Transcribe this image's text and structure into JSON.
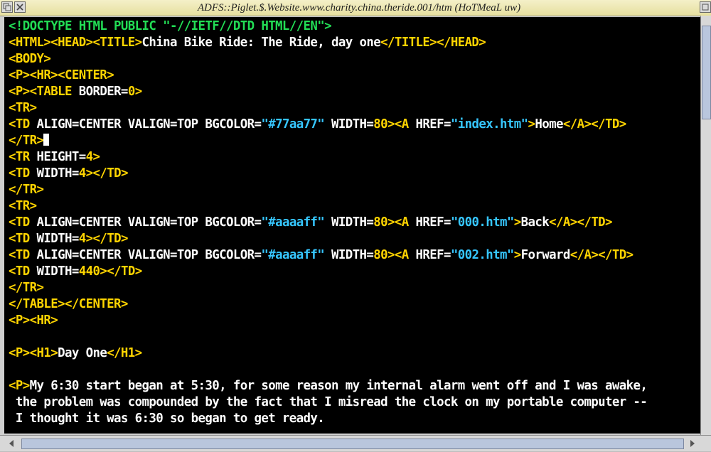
{
  "window": {
    "title": "ADFS::Piglet.$.Website.www.charity.china.theride.001/htm (HoTMeaL uw)"
  },
  "icons": [
    "back-icon",
    "close-icon",
    "toggle-size-icon",
    "scroll-left-arrow-icon",
    "scroll-right-arrow-icon"
  ],
  "colors": {
    "tag": "#ffd400",
    "comment": "#22dd55",
    "value": "#36c6ff",
    "text": "#ffffff",
    "background": "#000000"
  },
  "editor": {
    "lines": [
      [
        {
          "t": "c",
          "s": "<!DOCTYPE HTML PUBLIC \"-//IETF//DTD HTML//EN\">"
        }
      ],
      [
        {
          "t": "t",
          "s": "<HTML><HEAD><TITLE>"
        },
        {
          "t": "w",
          "s": "China Bike Ride: The Ride, day one"
        },
        {
          "t": "t",
          "s": "</TITLE></HEAD>"
        }
      ],
      [
        {
          "t": "t",
          "s": "<BODY>"
        }
      ],
      [
        {
          "t": "t",
          "s": "<P><HR><CENTER>"
        }
      ],
      [
        {
          "t": "t",
          "s": "<P><TABLE"
        },
        {
          "t": "w",
          "s": " BORDER="
        },
        {
          "t": "t",
          "s": "0"
        },
        {
          "t": "t",
          "s": ">"
        }
      ],
      [
        {
          "t": "t",
          "s": "<TR>"
        }
      ],
      [
        {
          "t": "t",
          "s": "<TD"
        },
        {
          "t": "w",
          "s": " ALIGN=CENTER VALIGN=TOP BGCOLOR="
        },
        {
          "t": "v",
          "s": "\"#77aa77\""
        },
        {
          "t": "w",
          "s": " WIDTH="
        },
        {
          "t": "t",
          "s": "80"
        },
        {
          "t": "t",
          "s": "><A"
        },
        {
          "t": "w",
          "s": " HREF="
        },
        {
          "t": "v",
          "s": "\"index.htm\""
        },
        {
          "t": "t",
          "s": ">"
        },
        {
          "t": "w",
          "s": "Home"
        },
        {
          "t": "t",
          "s": "</A></TD>"
        }
      ],
      [
        {
          "t": "t",
          "s": "</TR>"
        },
        {
          "t": "caret",
          "s": ""
        }
      ],
      [
        {
          "t": "t",
          "s": "<TR"
        },
        {
          "t": "w",
          "s": " HEIGHT="
        },
        {
          "t": "t",
          "s": "4"
        },
        {
          "t": "t",
          "s": ">"
        }
      ],
      [
        {
          "t": "t",
          "s": "<TD"
        },
        {
          "t": "w",
          "s": " WIDTH="
        },
        {
          "t": "t",
          "s": "4"
        },
        {
          "t": "t",
          "s": "></TD>"
        }
      ],
      [
        {
          "t": "t",
          "s": "</TR>"
        }
      ],
      [
        {
          "t": "t",
          "s": "<TR>"
        }
      ],
      [
        {
          "t": "t",
          "s": "<TD"
        },
        {
          "t": "w",
          "s": " ALIGN=CENTER VALIGN=TOP BGCOLOR="
        },
        {
          "t": "v",
          "s": "\"#aaaaff\""
        },
        {
          "t": "w",
          "s": " WIDTH="
        },
        {
          "t": "t",
          "s": "80"
        },
        {
          "t": "t",
          "s": "><A"
        },
        {
          "t": "w",
          "s": " HREF="
        },
        {
          "t": "v",
          "s": "\"000.htm\""
        },
        {
          "t": "t",
          "s": ">"
        },
        {
          "t": "w",
          "s": "Back"
        },
        {
          "t": "t",
          "s": "</A></TD>"
        }
      ],
      [
        {
          "t": "t",
          "s": "<TD"
        },
        {
          "t": "w",
          "s": " WIDTH="
        },
        {
          "t": "t",
          "s": "4"
        },
        {
          "t": "t",
          "s": "></TD>"
        }
      ],
      [
        {
          "t": "t",
          "s": "<TD"
        },
        {
          "t": "w",
          "s": " ALIGN=CENTER VALIGN=TOP BGCOLOR="
        },
        {
          "t": "v",
          "s": "\"#aaaaff\""
        },
        {
          "t": "w",
          "s": " WIDTH="
        },
        {
          "t": "t",
          "s": "80"
        },
        {
          "t": "t",
          "s": "><A"
        },
        {
          "t": "w",
          "s": " HREF="
        },
        {
          "t": "v",
          "s": "\"002.htm\""
        },
        {
          "t": "t",
          "s": ">"
        },
        {
          "t": "w",
          "s": "Forward"
        },
        {
          "t": "t",
          "s": "</A></TD>"
        }
      ],
      [
        {
          "t": "t",
          "s": "<TD"
        },
        {
          "t": "w",
          "s": " WIDTH="
        },
        {
          "t": "t",
          "s": "440"
        },
        {
          "t": "t",
          "s": "></TD>"
        }
      ],
      [
        {
          "t": "t",
          "s": "</TR>"
        }
      ],
      [
        {
          "t": "t",
          "s": "</TABLE></CENTER>"
        }
      ],
      [
        {
          "t": "t",
          "s": "<P><HR>"
        }
      ],
      [],
      [
        {
          "t": "t",
          "s": "<P><H1>"
        },
        {
          "t": "w",
          "s": "Day One"
        },
        {
          "t": "t",
          "s": "</H1>"
        }
      ],
      [],
      [
        {
          "t": "t",
          "s": "<P>"
        },
        {
          "t": "w",
          "s": "My 6:30 start began at 5:30, for some reason my internal alarm went off and I was awake,"
        }
      ],
      [
        {
          "t": "w",
          "s": " the problem was compounded by the fact that I misread the clock on my portable computer --"
        }
      ],
      [
        {
          "t": "w",
          "s": " I thought it was 6:30 so began to get ready."
        }
      ]
    ]
  }
}
